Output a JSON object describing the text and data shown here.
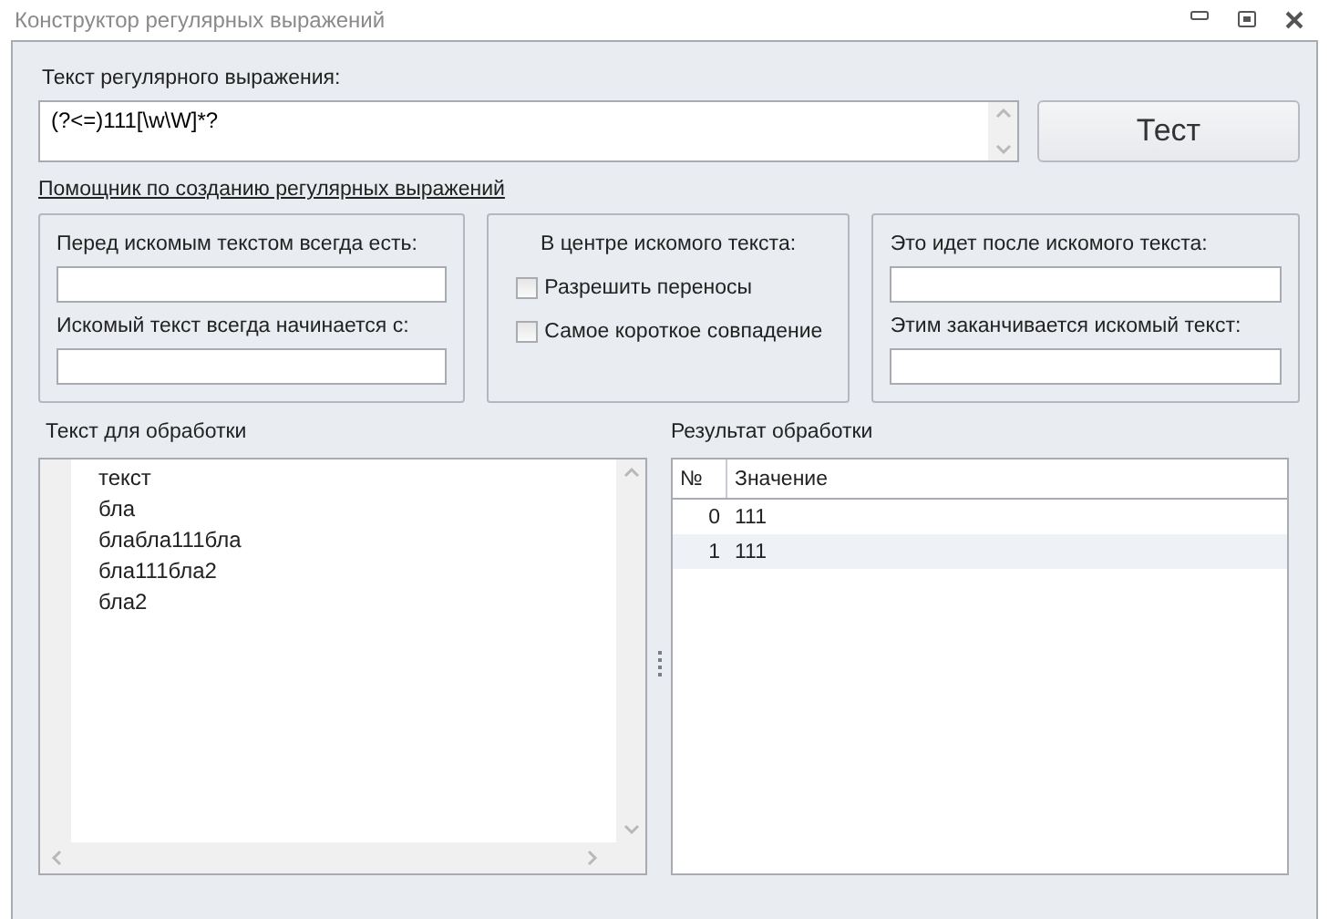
{
  "window": {
    "title": "Конструктор регулярных выражений"
  },
  "regex": {
    "label": "Текст регулярного выражения:",
    "value": "(?<=)111[\\w\\W]*?"
  },
  "test_button": "Тест",
  "helper_link": "Помощник по созданию регулярных выражений",
  "before_group": {
    "fields": [
      {
        "label": "Перед искомым текстом всегда есть:"
      },
      {
        "label": "Искомый текст всегда начинается с:"
      }
    ]
  },
  "center_group": {
    "title": "В центре искомого текста:",
    "options": [
      {
        "label": "Разрешить переносы",
        "checked": false
      },
      {
        "label": "Самое короткое совпадение",
        "checked": false
      }
    ]
  },
  "after_group": {
    "fields": [
      {
        "label": "Это идет после искомого текста:"
      },
      {
        "label": "Этим заканчивается искомый текст:"
      }
    ]
  },
  "input_text": {
    "label": "Текст для обработки",
    "lines": [
      "текст",
      "бла",
      "блабла111бла",
      "бла111бла2",
      "бла2"
    ]
  },
  "result": {
    "label": "Результат обработки",
    "columns": [
      "№",
      "Значение"
    ],
    "rows": [
      {
        "index": "0",
        "value": "111",
        "selected": false
      },
      {
        "index": "1",
        "value": "111",
        "selected": true
      }
    ]
  }
}
